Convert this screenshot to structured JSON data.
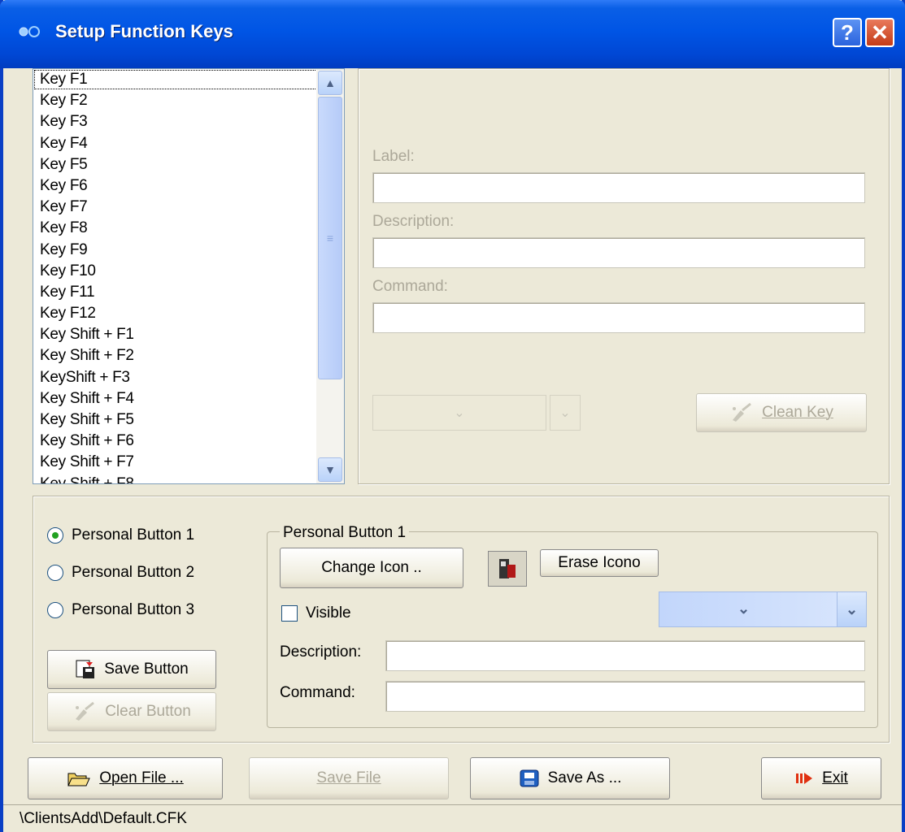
{
  "window": {
    "title": "Setup Function Keys",
    "help_label": "?",
    "close_label": "✕"
  },
  "keys_list": [
    "Key F1",
    "Key F2",
    "Key F3",
    "Key F4",
    "Key F5",
    "Key F6",
    "Key F7",
    "Key F8",
    "Key F9",
    "Key F10",
    "Key F11",
    "Key F12",
    "Key Shift + F1",
    "Key Shift + F2",
    "KeyShift + F3",
    "Key Shift + F4",
    "Key Shift + F5",
    "Key Shift + F6",
    "Key Shift + F7",
    "Key Shift + F8"
  ],
  "key_editor": {
    "label_caption": "Label:",
    "label_value": "",
    "description_caption": "Description:",
    "description_value": "",
    "command_caption": "Command:",
    "command_value": "",
    "clean_key_label": "Clean Key"
  },
  "personal": {
    "radios": [
      {
        "label": "Personal Button 1",
        "checked": true
      },
      {
        "label": "Personal Button  2",
        "checked": false
      },
      {
        "label": "Personal Button 3",
        "checked": false
      }
    ],
    "save_button_label": "Save Button",
    "clear_button_label": "Clear Button",
    "group_title": "Personal Button 1",
    "change_icon_label": "Change Icon ..",
    "erase_icon_label": "Erase Icono",
    "visible_label": "Visible",
    "visible_checked": false,
    "description_caption": "Description:",
    "description_value": "",
    "command_caption": "Command:",
    "command_value": ""
  },
  "footer": {
    "open_file_label": "Open File ...",
    "save_file_label": "Save File",
    "save_as_label": "Save As ...",
    "exit_label": "Exit"
  },
  "status": {
    "path": "\\ClientsAdd\\Default.CFK"
  },
  "colors": {
    "title_blue": "#0055e5",
    "face": "#ece9d8",
    "disabled_text": "#aca899"
  },
  "icons": [
    "app-icon",
    "help-icon",
    "close-icon",
    "scroll-up-icon",
    "scroll-down-icon",
    "broom-icon",
    "save-disk-icon",
    "open-folder-icon",
    "floppy-icon",
    "exit-arrow-icon",
    "chevron-down-icon"
  ]
}
